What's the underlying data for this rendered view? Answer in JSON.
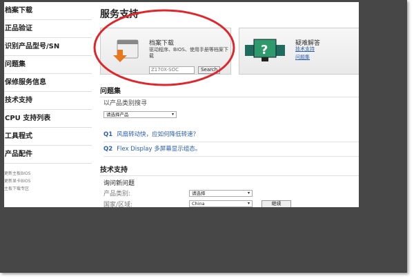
{
  "sidebar": {
    "items": [
      "档案下载",
      "正品验证",
      "识别产品型号/SN",
      "问题集",
      "保修服务信息",
      "技术支持",
      "CPU 支持列表",
      "工具程式",
      "产品配件"
    ],
    "small_links": [
      "更新主板BIOS",
      "更新显卡BIOS",
      "主板下载专区"
    ]
  },
  "main": {
    "title": "服务支持",
    "download_card": {
      "title": "档案下载",
      "desc": "驱动程序、BIOS、使用手册等档案下载",
      "search_value": "Z170X-SOC",
      "search_button": "Search"
    },
    "faq_card": {
      "title": "疑难解答",
      "links": [
        "技术支持",
        "问题集"
      ]
    },
    "faq_section": {
      "title": "问题集",
      "filter_label": "以产品类别搜寻",
      "select_value": "请选择产品",
      "questions": [
        {
          "num": "Q1",
          "text": "风扇转动快，应如何降低转速？"
        },
        {
          "num": "Q2",
          "text": "Flex Display 多屏幕显示组态。"
        }
      ]
    },
    "tech_section": {
      "title": "技术支持",
      "subtitle": "询问新问题",
      "category_label": "产品类别:",
      "category_value": "请选择",
      "region_label": "国家/区域:",
      "region_value": "China",
      "continue_button": "继续"
    }
  },
  "colors": {
    "annotation": "#e0262b",
    "link": "#2a5db0",
    "backdrop": "#474747"
  }
}
